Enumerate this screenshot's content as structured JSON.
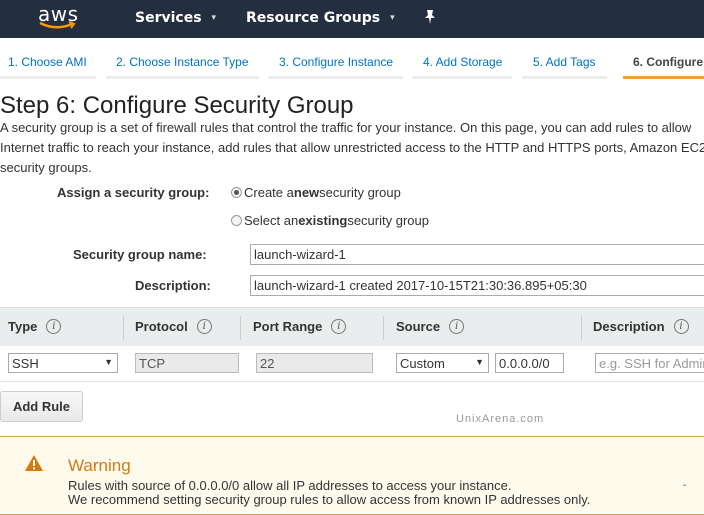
{
  "topnav": {
    "logo": "aws",
    "services": "Services",
    "resource_groups": "Resource Groups",
    "caret": "▾",
    "pin": "✦"
  },
  "tabs": [
    {
      "label": "1. Choose AMI",
      "active": false
    },
    {
      "label": "2. Choose Instance Type",
      "active": false
    },
    {
      "label": "3. Configure Instance",
      "active": false
    },
    {
      "label": "4. Add Storage",
      "active": false
    },
    {
      "label": "5. Add Tags",
      "active": false
    },
    {
      "label": "6. Configure",
      "active": true
    }
  ],
  "page": {
    "title": "Step 6: Configure Security Group",
    "intro": "A security group is a set of firewall rules that control the traffic for your instance. On this page, you can add rules to allow Internet traffic to reach your instance, add rules that allow unrestricted access to the HTTP and HTTPS ports, Amazon EC2 security groups."
  },
  "form": {
    "assign_label": "Assign a security group:",
    "radio_new_pre": "Create a ",
    "radio_new_bold": "new",
    "radio_new_post": " security group",
    "radio_existing_pre": "Select an ",
    "radio_existing_bold": "existing",
    "radio_existing_post": " security group",
    "selected": "new",
    "name_label": "Security group name:",
    "name_value": "launch-wizard-1",
    "desc_label": "Description:",
    "desc_value": "launch-wizard-1 created 2017-10-15T21:30:36.895+05:30"
  },
  "rules_table": {
    "headers": [
      "Type",
      "Protocol",
      "Port Range",
      "Source",
      "Description"
    ],
    "info_glyph": "i",
    "rows": [
      {
        "type": "SSH",
        "protocol": "TCP",
        "port_range": "22",
        "source_type": "Custom",
        "source_value": "0.0.0.0/0",
        "description_placeholder": "e.g. SSH for Admin Desktop"
      }
    ],
    "dropdown_arrow": "▼"
  },
  "add_rule_label": "Add Rule",
  "watermark": "UnixArena.com",
  "warning": {
    "title": "Warning",
    "line1": "Rules with source of 0.0.0.0/0 allow all IP addresses to access your instance.",
    "line2": "We recommend setting security group rules to allow access from known IP addresses only.",
    "chevron": "ˇ",
    "color": "#d47a12"
  },
  "colors": {
    "nav_bg": "#232f3e",
    "link": "#0073bb",
    "active_tab": "#e8a33a",
    "aws_smile": "#ff9900"
  }
}
